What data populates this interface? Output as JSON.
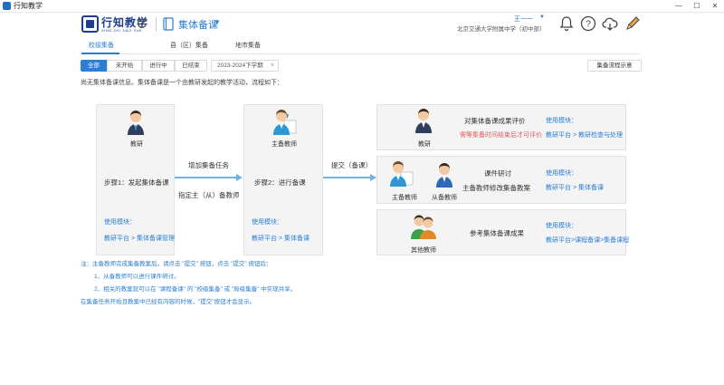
{
  "window": {
    "title": "行知教学"
  },
  "header": {
    "logo_text": "行知教学",
    "logo_sub": "XING ZHI JIAO XUE",
    "module": "集体备课",
    "user_name": "王一一",
    "school": "北京交通大学附属中学（初中部）"
  },
  "tabs": [
    {
      "label": "校级集备"
    },
    {
      "label": "县（区）集备"
    },
    {
      "label": "地市集备"
    }
  ],
  "filters": [
    {
      "label": "全部"
    },
    {
      "label": "未开始"
    },
    {
      "label": "进行中"
    },
    {
      "label": "已结束"
    }
  ],
  "term": {
    "value": "2023-2024下学期"
  },
  "flow_button": "集备流程示意",
  "intro": "尚无集体备课信息。集体备课是一个由教研发起的教学活动，流程如下：",
  "step1": {
    "role": "教研",
    "title": "步骤1：发起集体备课",
    "module_label": "使用模块：",
    "module_path": "教研平台 > 集体备课管理"
  },
  "arrow1": {
    "top": "增加集备任务",
    "bottom": "指定主（从）备教师"
  },
  "step2": {
    "role": "主备教师",
    "title": "步骤2：进行备课",
    "module_label": "使用模块：",
    "module_path": "教研平台 > 集体备课"
  },
  "arrow2": {
    "label": "提交（备课）"
  },
  "panel1": {
    "role": "教研",
    "title": "对集体备课成果评价",
    "hint": "需等集备时间结束后才可评价",
    "module_label": "使用模块：",
    "module_path": "教研平台 > 教研检查与处理"
  },
  "panel2": {
    "role_main": "主备教师",
    "role_sub": "从备教师",
    "title": "课件研讨",
    "subtitle": "主备教师修改集备教案",
    "module_label": "使用模块：",
    "module_path": "教研平台 > 集体备课"
  },
  "panel3": {
    "role": "其他教师",
    "title": "参考集体备课成果",
    "module_label": "使用模块：",
    "module_path": "教研平台>课程备课>集备课程"
  },
  "notes": [
    "注：主备教师完成集备教案后，请点击 \"提交\" 按钮，点击 \"提交\" 按钮后：",
    "1、从备教师可以进行课件研讨。",
    "2、相关的教案就可以在 \"课程备课\" 的 \"校级集备\" 或 \"局级集备\" 中实现共享。",
    "在集备任务开始且教案中已经有内容的时候，\"提交\"按钮才会显示。"
  ],
  "colors": {
    "accent": "#2a7fd4",
    "logo": "#1e3f8f",
    "arrow": "#6fb3e6",
    "hint": "#e06060"
  }
}
